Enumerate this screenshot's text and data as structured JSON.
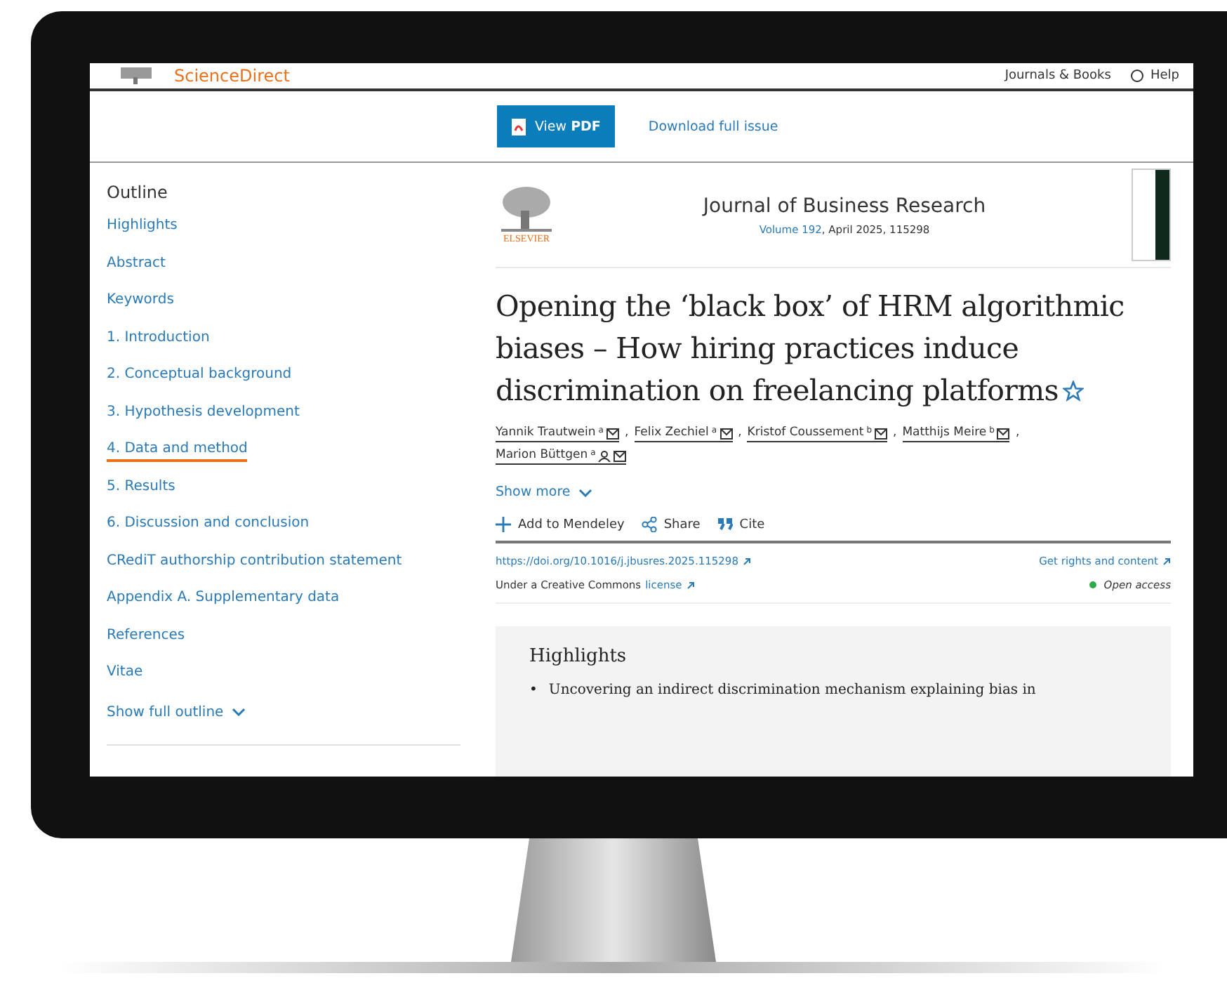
{
  "header": {
    "logo_text": "ScienceDirect",
    "links": [
      {
        "kind": "journals",
        "label": "Journals & Books"
      },
      {
        "kind": "help",
        "label": "Help"
      }
    ]
  },
  "toolbar": {
    "view_pdf": "View **PDF**",
    "download": "Download full issue"
  },
  "outline": {
    "title": "Outline",
    "items": [
      {
        "label": "Highlights",
        "selected": false
      },
      {
        "label": "Abstract",
        "selected": false
      },
      {
        "label": "Keywords",
        "selected": false
      },
      {
        "label": "1. Introduction",
        "selected": false
      },
      {
        "label": "2. Conceptual background",
        "selected": false
      },
      {
        "label": "3. Hypothesis development",
        "selected": false
      },
      {
        "label": "4. Data and method",
        "selected": true
      },
      {
        "label": "5. Results",
        "selected": false
      },
      {
        "label": "6. Discussion and conclusion",
        "selected": false
      },
      {
        "label": "CRediT authorship contribution statement",
        "selected": false
      },
      {
        "label": "Appendix A. Supplementary data",
        "selected": false
      },
      {
        "label": "References",
        "selected": false
      },
      {
        "label": "Vitae",
        "selected": false
      }
    ],
    "show_full": "Show full outline"
  },
  "journal": {
    "publisher": "ELSEVIER",
    "name": "Journal of Business Research",
    "volume_link": "Volume 192",
    "volume_rest": ", April 2025, 115298"
  },
  "article": {
    "title": "Opening the ‘black box’ of HRM algorithmic biases – How hiring practices induce discrimination on freelancing platforms",
    "authors": [
      {
        "name": "Yannik Trautwein",
        "affiliation": "a",
        "corresponding": false
      },
      {
        "name": "Felix Zechiel",
        "affiliation": "a",
        "corresponding": false
      },
      {
        "name": "Kristof Coussement",
        "affiliation": "b",
        "corresponding": false
      },
      {
        "name": "Matthijs Meire",
        "affiliation": "b",
        "corresponding": false
      },
      {
        "name": "Marion Büttgen",
        "affiliation": "a",
        "corresponding": true
      }
    ],
    "author_separator": ",",
    "show_more": "Show more",
    "actions": [
      {
        "kind": "add",
        "label": "Add to Mendeley"
      },
      {
        "kind": "share",
        "label": "Share"
      },
      {
        "kind": "cite",
        "label": "Cite"
      }
    ],
    "doi": "https://doi.org/10.1016/j.jbusres.2025.115298",
    "rights": "Get rights and content",
    "license_text": "Under a Creative Commons",
    "license_link": "license",
    "access": "Open access"
  },
  "highlights": {
    "title": "Highlights",
    "items": [
      {
        "bullet": "•",
        "text": "Uncovering an indirect discrimination mechanism explaining bias in"
      }
    ]
  }
}
